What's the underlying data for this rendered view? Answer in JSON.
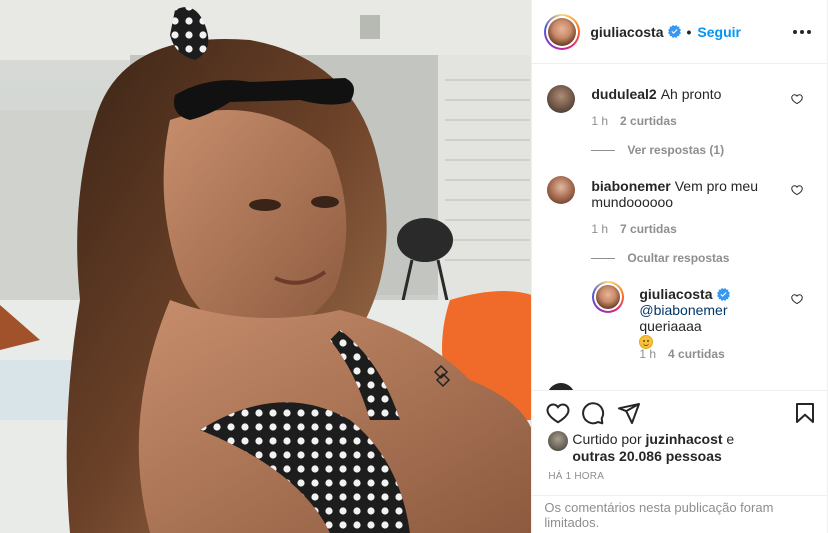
{
  "post": {
    "author": "giuliacosta",
    "follow_label": "Seguir",
    "dot": "•",
    "image_alt": "Photo of woman in polka-dot bikini smiling by a pool deck"
  },
  "comments": [
    {
      "user": "duduleal2",
      "text": "Ah pronto",
      "time": "1 h",
      "likes": "2 curtidas",
      "replies_toggle": "Ver respostas (1)"
    },
    {
      "user": "biabonemer",
      "text": "Vem pro meu mundoooooo",
      "time": "1 h",
      "likes": "7 curtidas",
      "replies_toggle": "Ocultar respostas"
    }
  ],
  "reply": {
    "user": "giuliacosta",
    "mention": "@biabonemer",
    "text": " queriaaaa",
    "emoji": "smiling-face",
    "time": "1 h",
    "likes": "4 curtidas"
  },
  "liked_by": {
    "prefix": "Curtido por",
    "user": "juzinhacost",
    "middle": "e",
    "others": "outras 20.086 pessoas"
  },
  "timestamp": "HÁ 1 HORA",
  "comments_limited": "Os comentários nesta publicação foram limitados.",
  "colors": {
    "link": "#0095f6",
    "mention": "#00376b",
    "muted": "#8e8e8e",
    "verified": "#3897f0"
  }
}
